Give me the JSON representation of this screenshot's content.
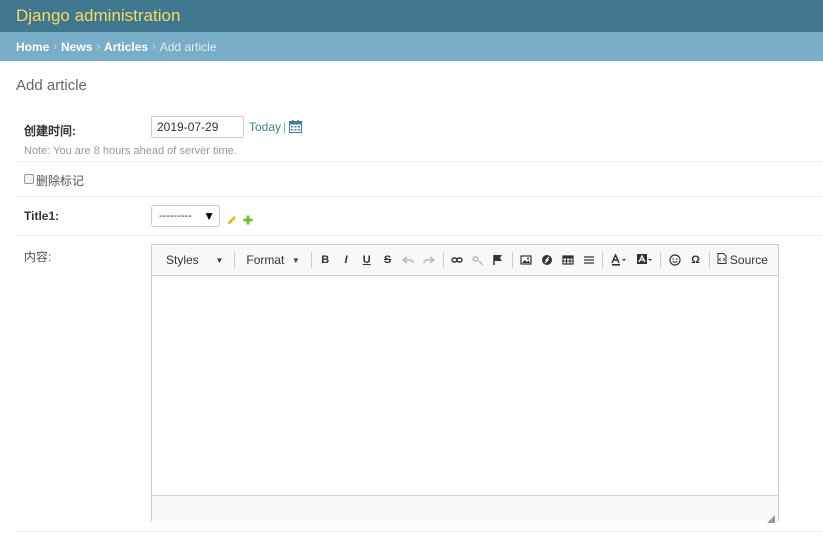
{
  "header": {
    "branding": "Django administration"
  },
  "breadcrumbs": {
    "items": [
      "Home",
      "News",
      "Articles"
    ],
    "separator": "›",
    "current": "Add article"
  },
  "page": {
    "title": "Add article"
  },
  "form": {
    "created_time": {
      "label": "创建时间:",
      "value": "2019-07-29",
      "today_label": "Today",
      "divider": "|",
      "note": "Note: You are 8 hours ahead of server time."
    },
    "deleted_flag": {
      "label": "删除标记"
    },
    "title1": {
      "label": "Title1:",
      "selected": "---------"
    },
    "content": {
      "label": "内容:",
      "toolbar": {
        "styles_label": "Styles",
        "format_label": "Format",
        "bold": "B",
        "italic": "I",
        "underline": "U",
        "strike": "S",
        "source_label": "Source"
      }
    }
  },
  "colors": {
    "header_bg": "#417690",
    "branding": "#f5dd5d",
    "breadcrumbs_bg": "#79aec8",
    "link": "#447e9b",
    "add_icon": "#70bf2b",
    "change_icon": "#efb80b"
  }
}
